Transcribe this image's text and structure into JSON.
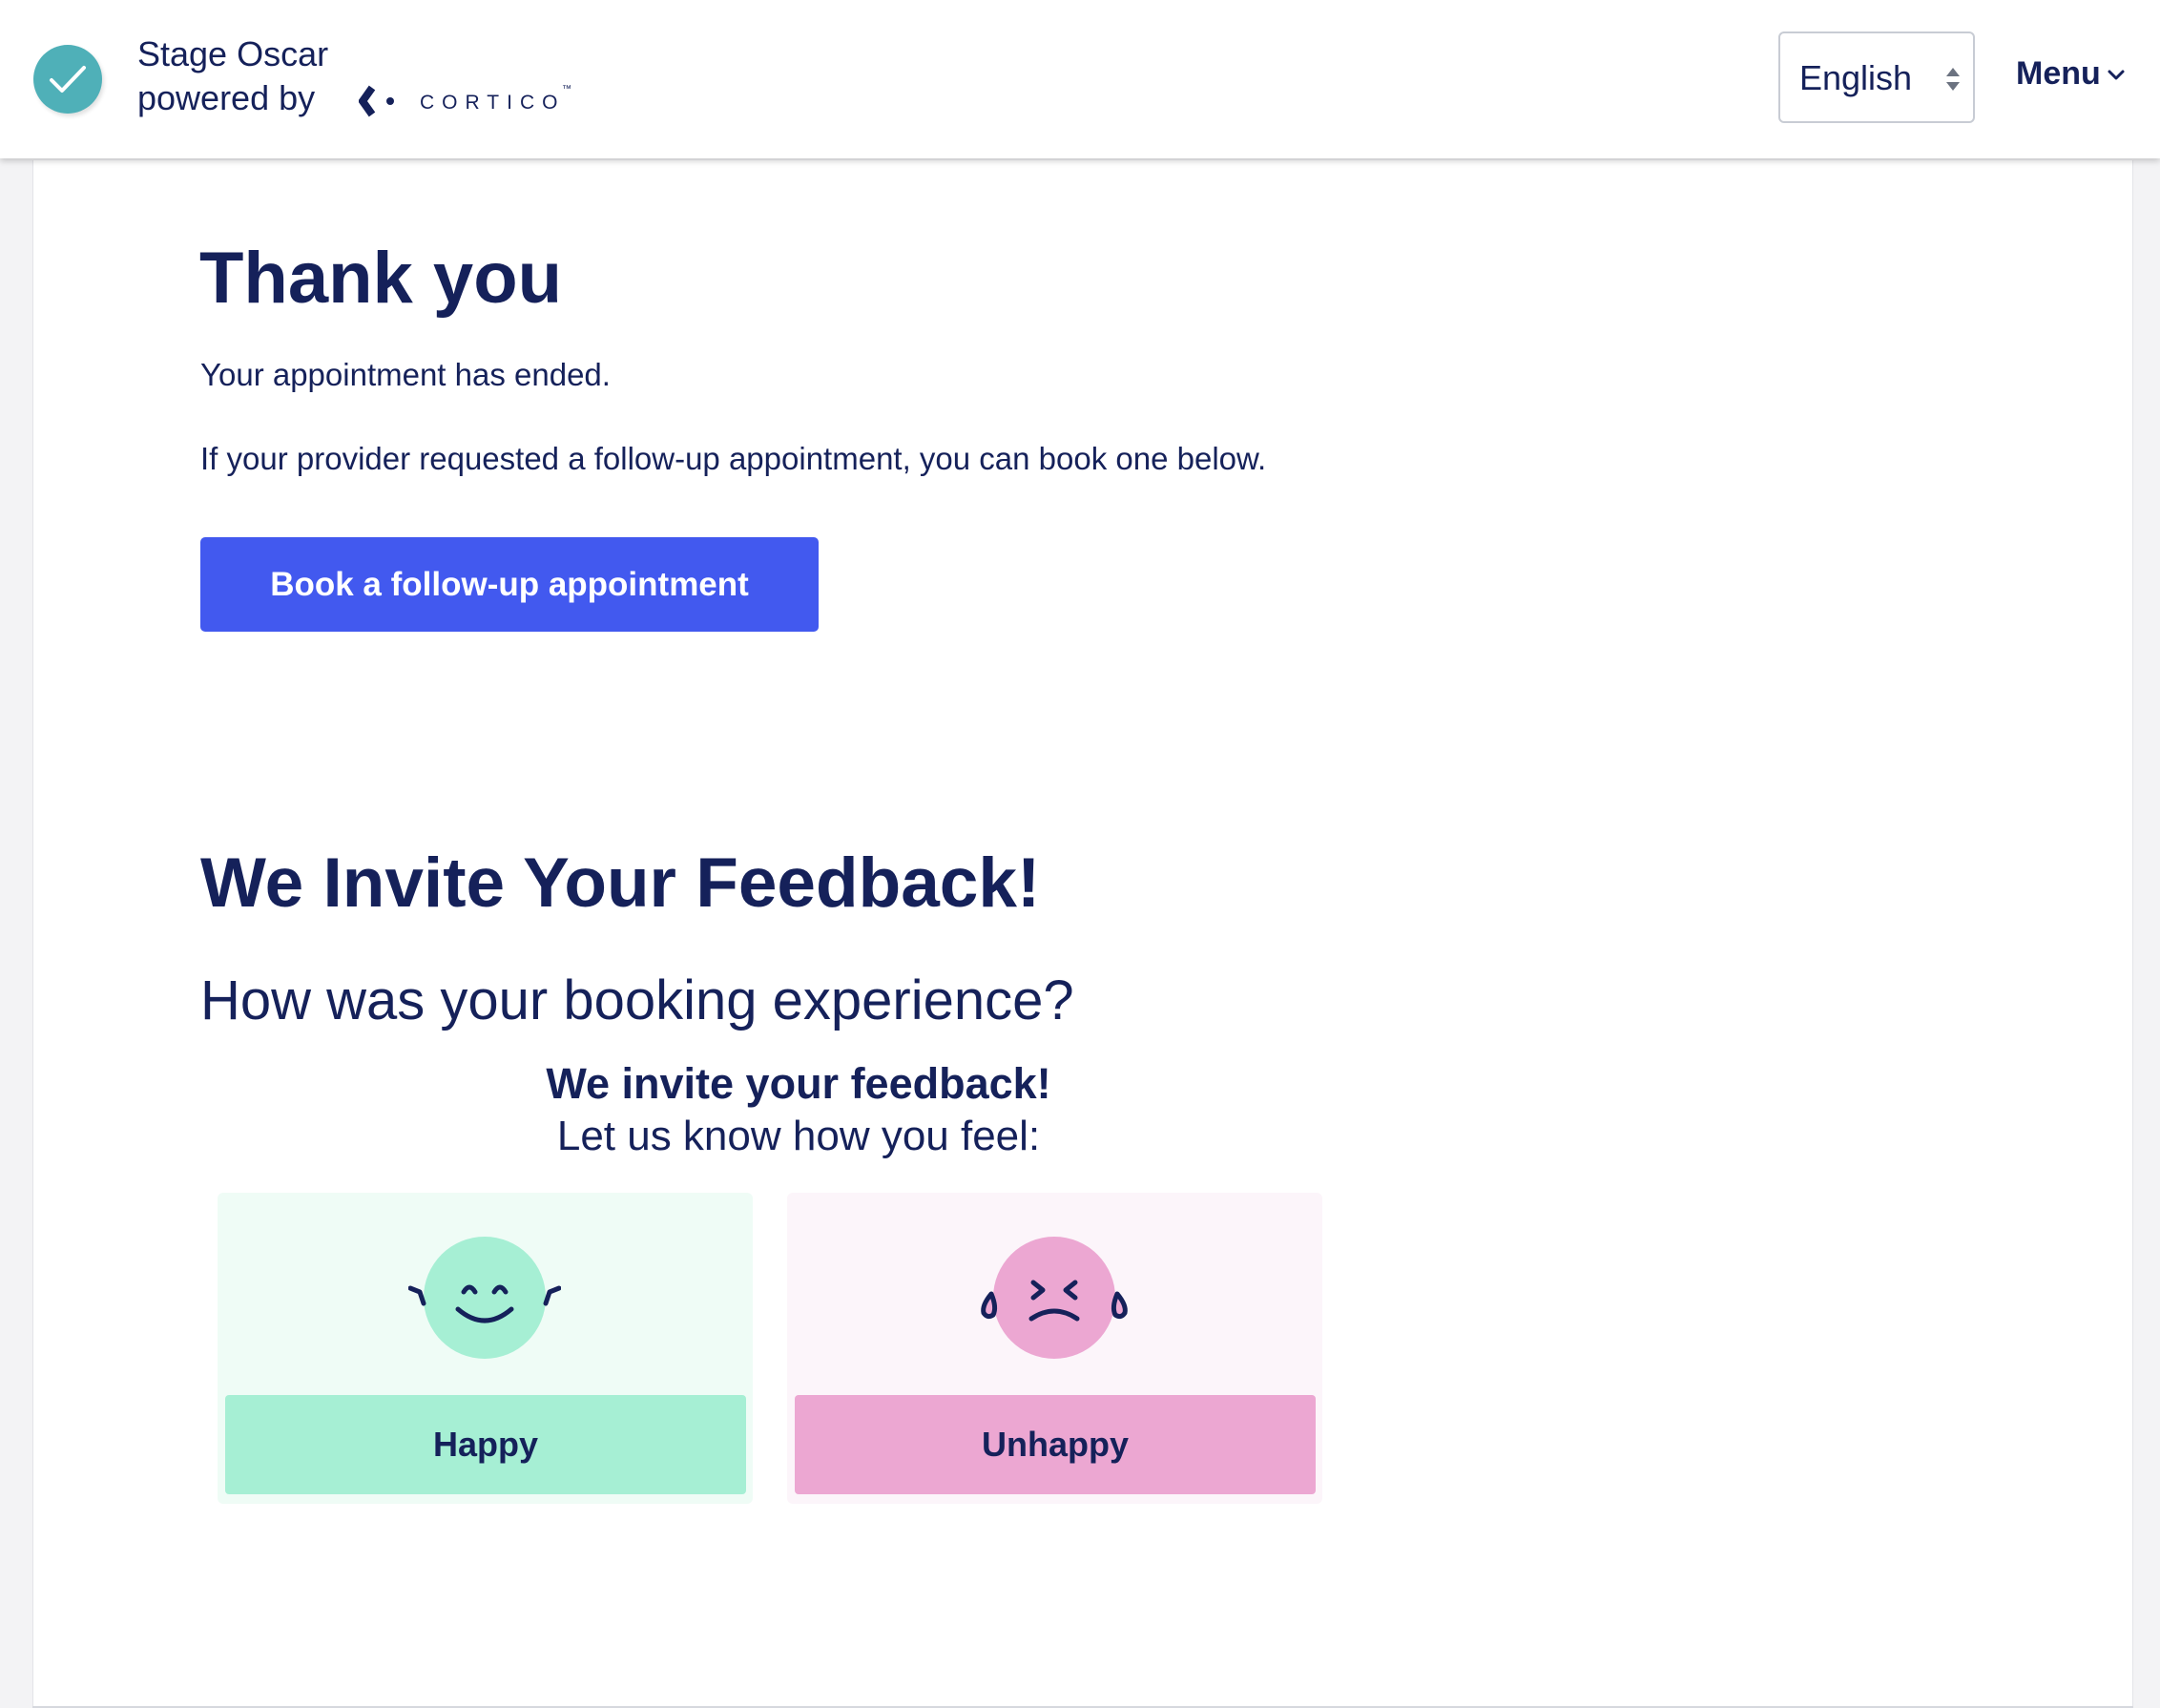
{
  "header": {
    "clinic_name": "Stage Oscar",
    "powered_by": "powered by",
    "cortico_logo_text": "CORTICO",
    "cortico_tm": "™",
    "language": {
      "selected": "English"
    },
    "menu_label": "Menu"
  },
  "main": {
    "title": "Thank you",
    "ended_text": "Your appointment has ended.",
    "followup_text": "If your provider requested a follow-up appointment, you can book one below.",
    "book_button": "Book a follow-up appointment"
  },
  "feedback": {
    "heading": "We Invite Your Feedback!",
    "question": "How was your booking experience?",
    "invite": "We invite your feedback!",
    "prompt": "Let us know how you feel:",
    "options": [
      {
        "label": "Happy",
        "icon": "happy-face-icon",
        "color": "#a6efd4"
      },
      {
        "label": "Unhappy",
        "icon": "sad-face-icon",
        "color": "#eca7d2"
      }
    ]
  },
  "colors": {
    "primary": "#4259ef",
    "text": "#15215a",
    "brand_teal": "#4fb0b8"
  }
}
